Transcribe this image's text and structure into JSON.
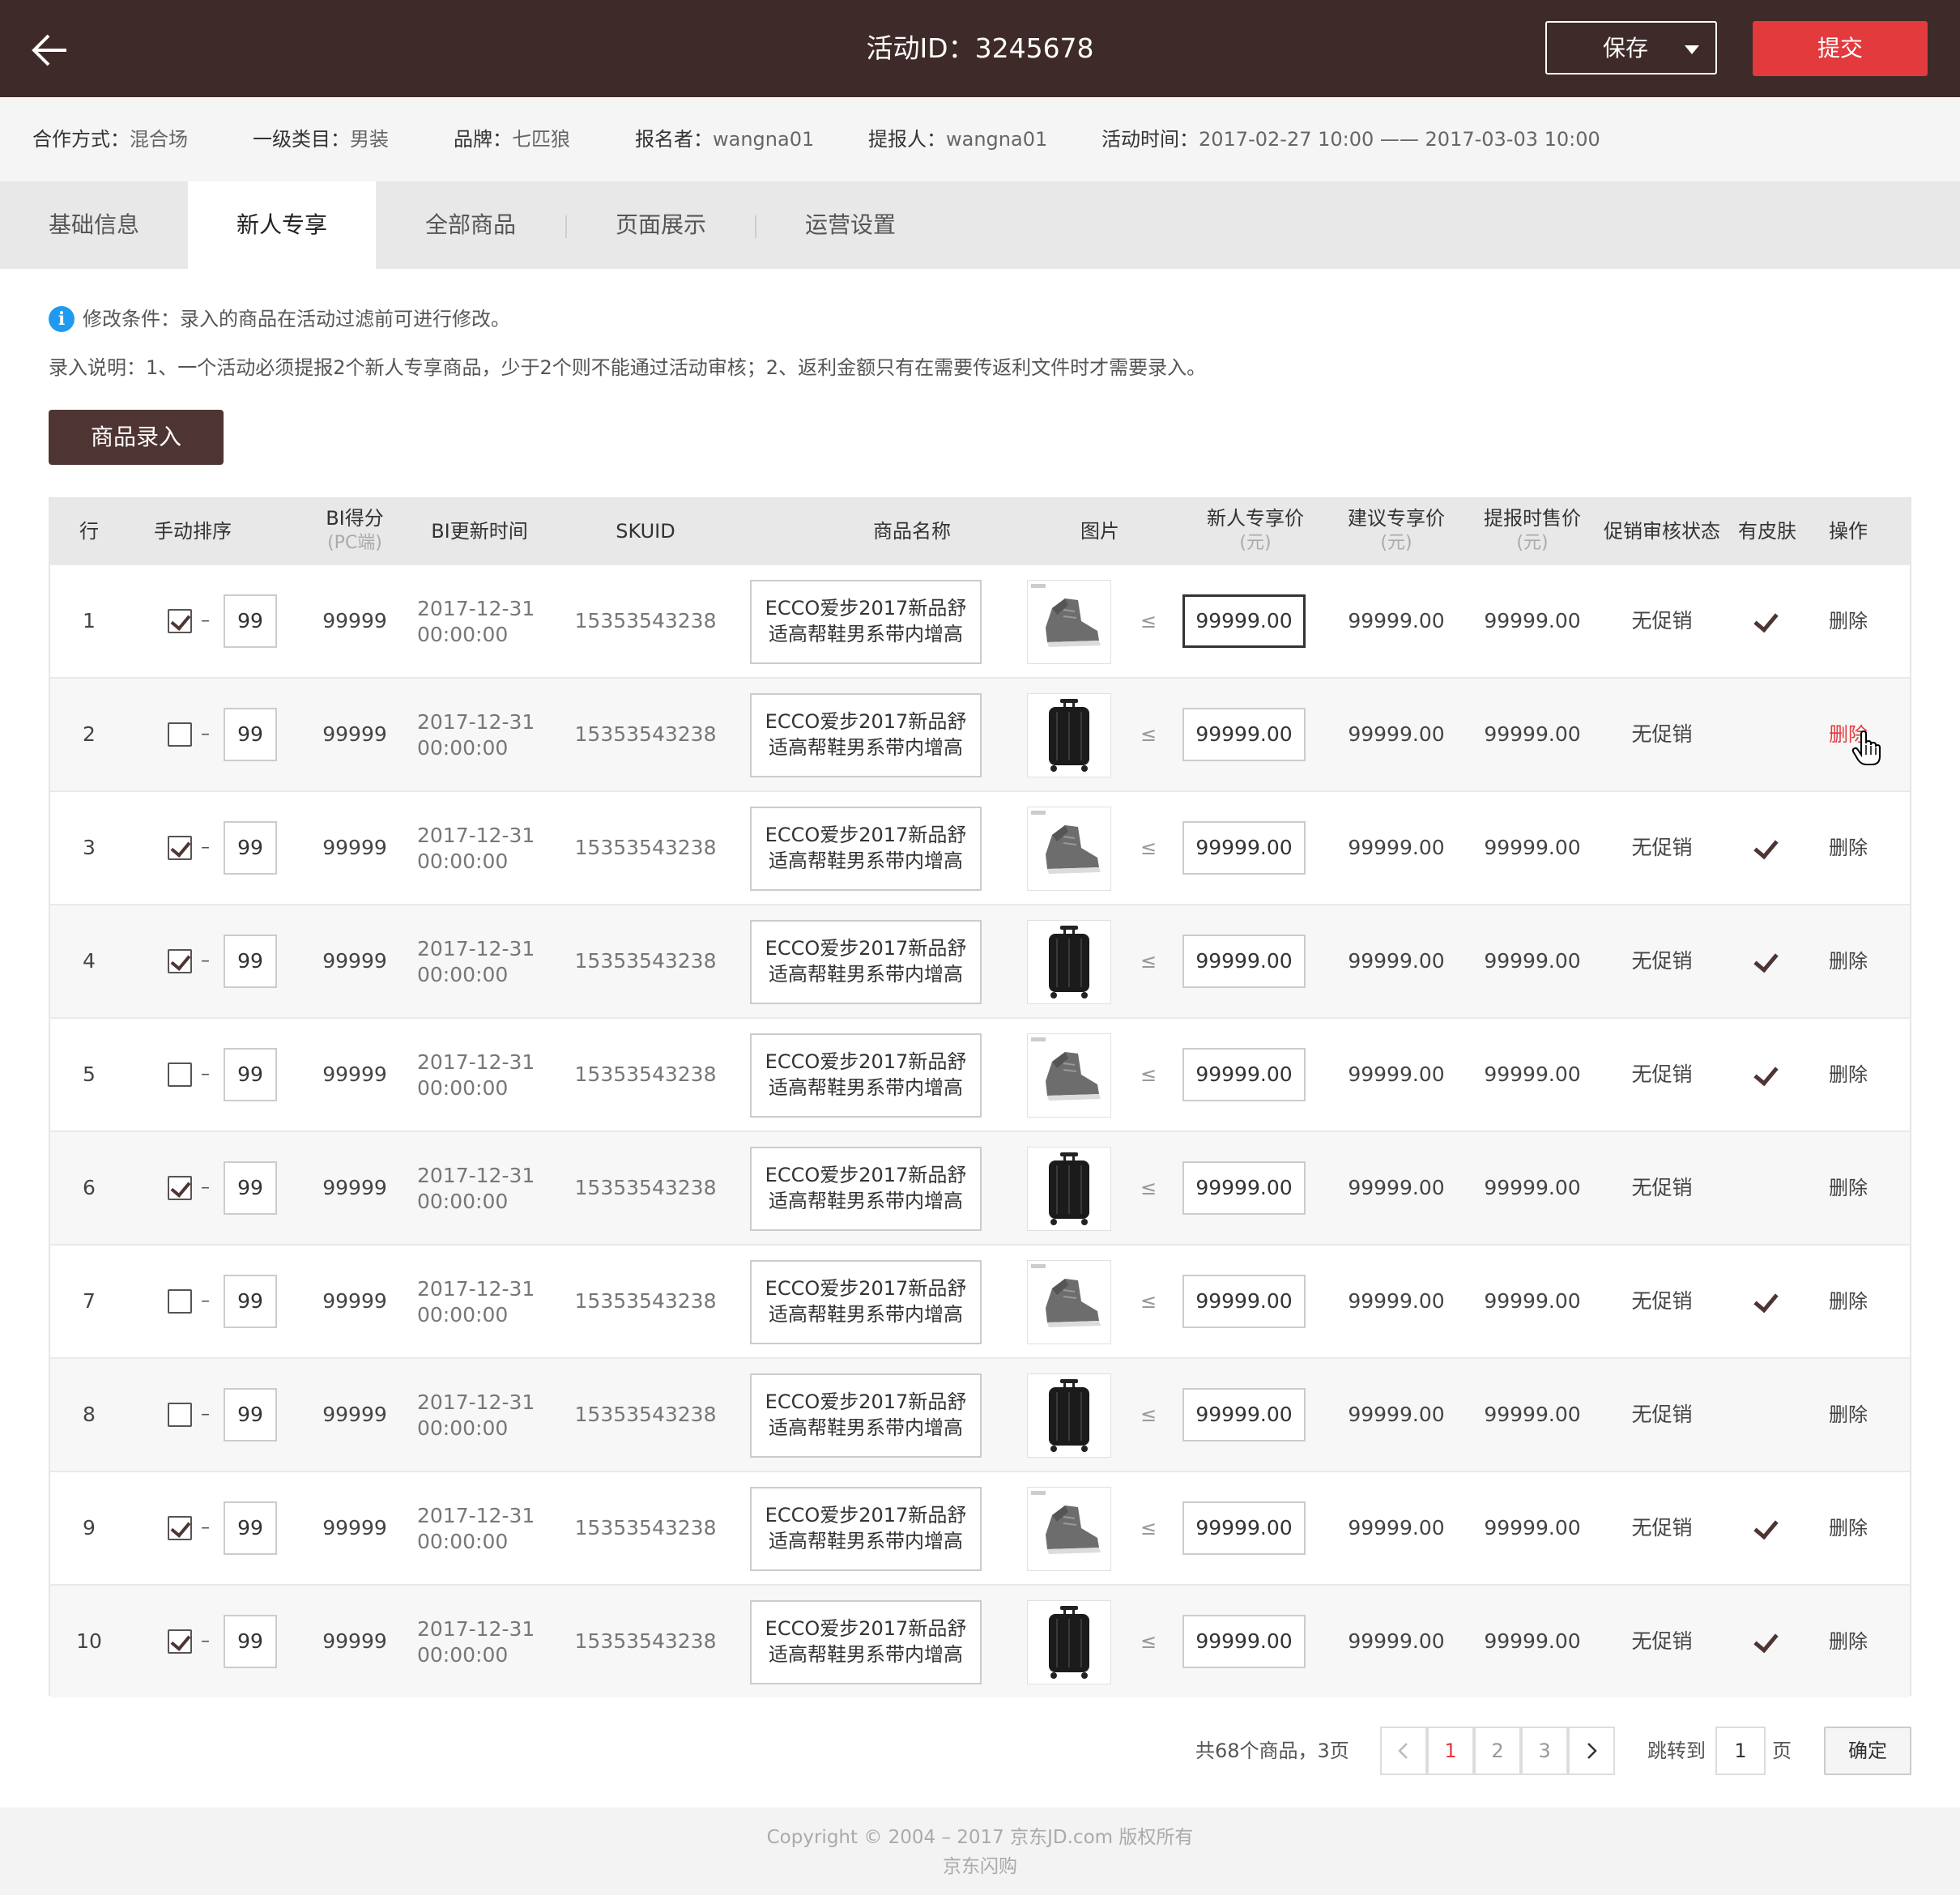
{
  "header": {
    "title": "活动ID：3245678",
    "save_label": "保存",
    "submit_label": "提交",
    "back_icon": "arrow-left-icon"
  },
  "meta": [
    {
      "key": "合作方式：",
      "value": "混合场"
    },
    {
      "key": "一级类目：",
      "value": "男装"
    },
    {
      "key": "品牌：",
      "value": "七匹狼"
    },
    {
      "key": "报名者：",
      "value": "wangna01"
    },
    {
      "key": "提报人：",
      "value": "wangna01"
    },
    {
      "key": "活动时间：",
      "value": "2017-02-27 10:00 —— 2017-03-03 10:00"
    }
  ],
  "tabs": [
    "基础信息",
    "新人专享",
    "全部商品",
    "页面展示",
    "运营设置"
  ],
  "active_tab": "新人专享",
  "notice": {
    "condition": "修改条件：录入的商品在活动过滤前可进行修改。",
    "instruction": "录入说明：1、一个活动必须提报2个新人专享商品，少于2个则不能通过活动审核；2、返利金额只有在需要传返利文件时才需要录入。"
  },
  "entry_button": "商品录入",
  "table": {
    "headers": {
      "row": "行",
      "sort": "手动排序",
      "bi_score": "BI得分",
      "bi_score_sub": "(PC端)",
      "bi_time": "BI更新时间",
      "skuid": "SKUID",
      "name": "商品名称",
      "image": "图片",
      "new_price": "新人专享价",
      "new_price_sub": "(元)",
      "suggest_price": "建议专享价",
      "suggest_price_sub": "(元)",
      "sale_price": "提报时售价",
      "sale_price_sub": "(元)",
      "promo_status": "促销审核状态",
      "skin": "有皮肤",
      "action": "操作"
    },
    "lte_symbol": "≤",
    "rows": [
      {
        "row": "1",
        "checked": true,
        "dash": "–",
        "sort": "99",
        "bi": "99999",
        "date": "2017-12-31",
        "time": "00:00:00",
        "skuid": "15353543238",
        "name1": "ECCO爱步2017新品舒",
        "name2": "适高帮鞋男系带内增高",
        "image": "shoe",
        "new_price": "99999.00",
        "suggest": "99999.00",
        "sale": "99999.00",
        "promo": "无促销",
        "skin": true,
        "action": "删除"
      },
      {
        "row": "2",
        "checked": false,
        "dash": "–",
        "sort": "99",
        "bi": "99999",
        "date": "2017-12-31",
        "time": "00:00:00",
        "skuid": "15353543238",
        "name1": "ECCO爱步2017新品舒",
        "name2": "适高帮鞋男系带内增高",
        "image": "suitcase",
        "new_price": "99999.00",
        "suggest": "99999.00",
        "sale": "99999.00",
        "promo": "无促销",
        "skin": false,
        "action": "删除"
      },
      {
        "row": "3",
        "checked": true,
        "dash": "–",
        "sort": "99",
        "bi": "99999",
        "date": "2017-12-31",
        "time": "00:00:00",
        "skuid": "15353543238",
        "name1": "ECCO爱步2017新品舒",
        "name2": "适高帮鞋男系带内增高",
        "image": "shoe",
        "new_price": "99999.00",
        "suggest": "99999.00",
        "sale": "99999.00",
        "promo": "无促销",
        "skin": true,
        "action": "删除"
      },
      {
        "row": "4",
        "checked": true,
        "dash": "–",
        "sort": "99",
        "bi": "99999",
        "date": "2017-12-31",
        "time": "00:00:00",
        "skuid": "15353543238",
        "name1": "ECCO爱步2017新品舒",
        "name2": "适高帮鞋男系带内增高",
        "image": "suitcase",
        "new_price": "99999.00",
        "suggest": "99999.00",
        "sale": "99999.00",
        "promo": "无促销",
        "skin": true,
        "action": "删除"
      },
      {
        "row": "5",
        "checked": false,
        "dash": "–",
        "sort": "99",
        "bi": "99999",
        "date": "2017-12-31",
        "time": "00:00:00",
        "skuid": "15353543238",
        "name1": "ECCO爱步2017新品舒",
        "name2": "适高帮鞋男系带内增高",
        "image": "shoe",
        "new_price": "99999.00",
        "suggest": "99999.00",
        "sale": "99999.00",
        "promo": "无促销",
        "skin": true,
        "action": "删除"
      },
      {
        "row": "6",
        "checked": true,
        "dash": "–",
        "sort": "99",
        "bi": "99999",
        "date": "2017-12-31",
        "time": "00:00:00",
        "skuid": "15353543238",
        "name1": "ECCO爱步2017新品舒",
        "name2": "适高帮鞋男系带内增高",
        "image": "suitcase",
        "new_price": "99999.00",
        "suggest": "99999.00",
        "sale": "99999.00",
        "promo": "无促销",
        "skin": false,
        "action": "删除"
      },
      {
        "row": "7",
        "checked": false,
        "dash": "–",
        "sort": "99",
        "bi": "99999",
        "date": "2017-12-31",
        "time": "00:00:00",
        "skuid": "15353543238",
        "name1": "ECCO爱步2017新品舒",
        "name2": "适高帮鞋男系带内增高",
        "image": "shoe",
        "new_price": "99999.00",
        "suggest": "99999.00",
        "sale": "99999.00",
        "promo": "无促销",
        "skin": true,
        "action": "删除"
      },
      {
        "row": "8",
        "checked": false,
        "dash": "–",
        "sort": "99",
        "bi": "99999",
        "date": "2017-12-31",
        "time": "00:00:00",
        "skuid": "15353543238",
        "name1": "ECCO爱步2017新品舒",
        "name2": "适高帮鞋男系带内增高",
        "image": "suitcase",
        "new_price": "99999.00",
        "suggest": "99999.00",
        "sale": "99999.00",
        "promo": "无促销",
        "skin": false,
        "action": "删除"
      },
      {
        "row": "9",
        "checked": true,
        "dash": "–",
        "sort": "99",
        "bi": "99999",
        "date": "2017-12-31",
        "time": "00:00:00",
        "skuid": "15353543238",
        "name1": "ECCO爱步2017新品舒",
        "name2": "适高帮鞋男系带内增高",
        "image": "shoe",
        "new_price": "99999.00",
        "suggest": "99999.00",
        "sale": "99999.00",
        "promo": "无促销",
        "skin": true,
        "action": "删除"
      },
      {
        "row": "10",
        "checked": true,
        "dash": "–",
        "sort": "99",
        "bi": "99999",
        "date": "2017-12-31",
        "time": "00:00:00",
        "skuid": "15353543238",
        "name1": "ECCO爱步2017新品舒",
        "name2": "适高帮鞋男系带内增高",
        "image": "suitcase",
        "new_price": "99999.00",
        "suggest": "99999.00",
        "sale": "99999.00",
        "promo": "无促销",
        "skin": true,
        "action": "删除"
      }
    ],
    "hovered_action_row": "2",
    "focused_price_row": "1"
  },
  "pagination": {
    "total": "共68个商品，3页",
    "pages": [
      "1",
      "2",
      "3"
    ],
    "current": "1",
    "prev_icon": "chevron-left-icon",
    "next_icon": "chevron-right-icon",
    "jump_label": "跳转到",
    "jump_value": "1",
    "page_suffix": "页",
    "confirm": "确定"
  },
  "footer": {
    "copyright": "Copyright © 2004 – 2017  京东JD.com 版权所有",
    "brand": "京东闪购"
  },
  "colors": {
    "header_bg": "#3e2a28",
    "accent_red": "#e23a3d",
    "primary_brown": "#4e3533",
    "info_blue": "#1e9bf0"
  }
}
